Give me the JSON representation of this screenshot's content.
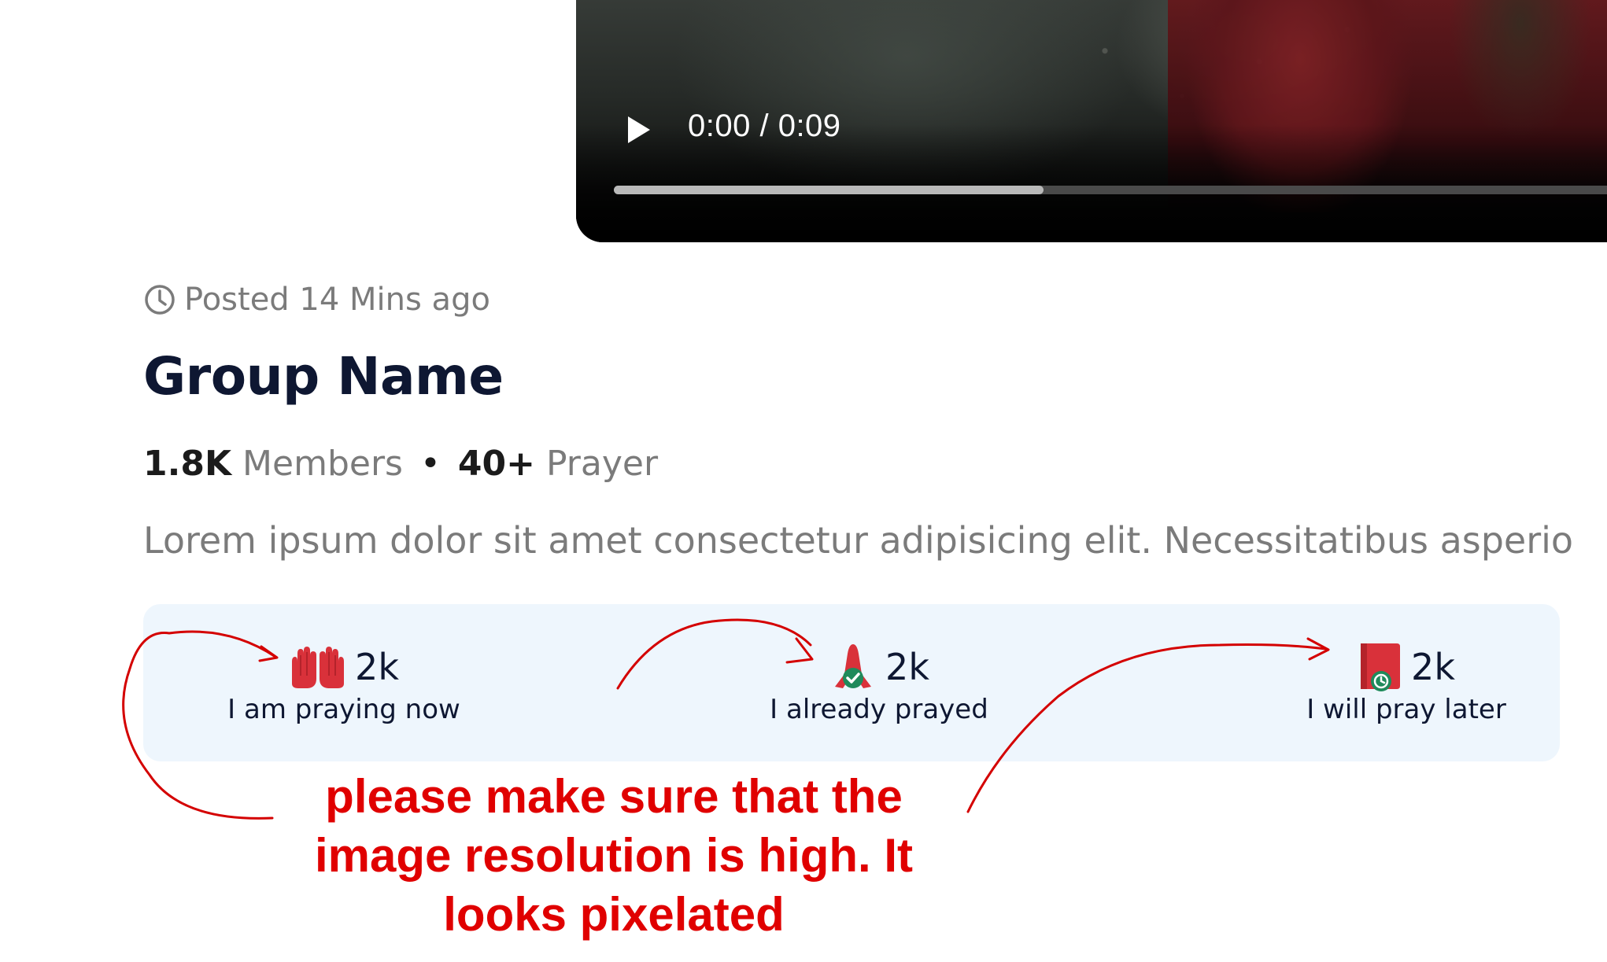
{
  "video": {
    "time": "0:00 / 0:09",
    "progress": 0.39
  },
  "post": {
    "posted": "Posted 14 Mins ago",
    "group_name": "Group Name",
    "members_count": "1.8K",
    "members_label": "Members",
    "separator": "•",
    "prayer_count": "40+",
    "prayer_label": "Prayer",
    "description": "Lorem ipsum dolor sit amet consectetur adipisicing elit. Necessitatibus asperio"
  },
  "reactions": [
    {
      "icon": "praying-hands-icon",
      "count": "2k",
      "label": "I am praying now"
    },
    {
      "icon": "prayed-check-icon",
      "count": "2k",
      "label": "I already prayed"
    },
    {
      "icon": "pray-later-clock-icon",
      "count": "2k",
      "label": "I will pray later"
    }
  ],
  "annotation": {
    "text": "please make sure that the image resolution is high. It looks pixelated",
    "color": "#e00000"
  },
  "colors": {
    "reaction_bg": "#eef6fd",
    "title": "#0e1732",
    "muted": "#7b7b7b",
    "icon_red": "#d9313a",
    "icon_green": "#1f8a5b"
  }
}
